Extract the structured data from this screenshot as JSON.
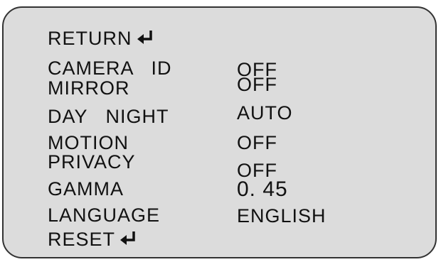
{
  "menu": {
    "return_label": "RETURN",
    "return_icon": "enter-arrow-icon",
    "items": [
      {
        "label": "CAMERA   ID",
        "value": "OFF"
      },
      {
        "label": "MIRROR",
        "value": "OFF"
      },
      {
        "label": "DAY   NIGHT",
        "value": "AUTO"
      },
      {
        "label": "MOTION",
        "value": "OFF"
      },
      {
        "label": "PRIVACY",
        "value": "OFF"
      },
      {
        "label": "GAMMA",
        "value": "0. 45"
      },
      {
        "label": "LANGUAGE",
        "value": "ENGLISH"
      }
    ],
    "reset_label": "RESET",
    "reset_icon": "enter-arrow-icon"
  },
  "colors": {
    "background": "#dcdcdc",
    "border": "#333333",
    "text": "#111111"
  }
}
